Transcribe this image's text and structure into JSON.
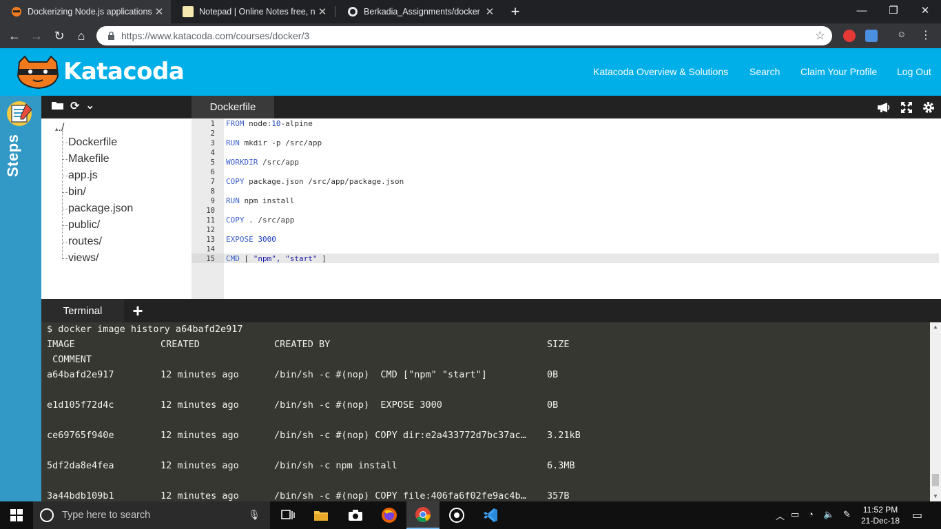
{
  "browser": {
    "tabs": [
      {
        "title": "Dockerizing Node.js applications",
        "active": true
      },
      {
        "title": "Notepad | Online Notes free, no",
        "active": false
      },
      {
        "title": "Berkadia_Assignments/docker ex",
        "active": false
      }
    ],
    "new_tab": "+",
    "url": "https://www.katacoda.com/courses/docker/3"
  },
  "header": {
    "logo_text": "Katacoda",
    "nav": [
      {
        "label": "Katacoda Overview & Solutions"
      },
      {
        "label": "Search"
      },
      {
        "label": "Claim Your Profile"
      },
      {
        "label": "Log Out"
      }
    ]
  },
  "sidebar": {
    "label": "Steps"
  },
  "file_tree": {
    "root": "./",
    "items": [
      "Dockerfile",
      "Makefile",
      "app.js",
      "bin/",
      "package.json",
      "public/",
      "routes/",
      "views/"
    ]
  },
  "editor": {
    "tab": "Dockerfile",
    "lines": [
      {
        "n": "1",
        "kw": "FROM",
        "rest": " node:",
        "num": "10",
        "tail": "-alpine"
      },
      {
        "n": "2"
      },
      {
        "n": "3",
        "kw": "RUN",
        "rest": " mkdir -p /src/app"
      },
      {
        "n": "4"
      },
      {
        "n": "5",
        "kw": "WORKDIR",
        "rest": " /src/app"
      },
      {
        "n": "6"
      },
      {
        "n": "7",
        "kw": "COPY",
        "rest": " package.json /src/app/package.json"
      },
      {
        "n": "8"
      },
      {
        "n": "9",
        "kw": "RUN",
        "rest": " npm install"
      },
      {
        "n": "10"
      },
      {
        "n": "11",
        "kw": "COPY",
        "rest": " . /src/app"
      },
      {
        "n": "12"
      },
      {
        "n": "13",
        "kw": "EXPOSE",
        "rest": " ",
        "num": "3000"
      },
      {
        "n": "14"
      },
      {
        "n": "15",
        "kw": "CMD",
        "rest": " [ ",
        "str": "\"npm\", \"start\"",
        "tail": " ]"
      }
    ]
  },
  "terminal": {
    "tab": "Terminal",
    "command": "$ docker image history a64bafd2e917",
    "headers": {
      "image": "IMAGE",
      "created": "CREATED",
      "created_by": "CREATED BY",
      "size": "SIZE",
      "comment": " COMMENT"
    },
    "rows": [
      {
        "image": "a64bafd2e917",
        "created": "12 minutes ago",
        "created_by": "/bin/sh -c #(nop)  CMD [\"npm\" \"start\"]",
        "size": "0B"
      },
      {
        "image": "e1d105f72d4c",
        "created": "12 minutes ago",
        "created_by": "/bin/sh -c #(nop)  EXPOSE 3000",
        "size": "0B"
      },
      {
        "image": "ce69765f940e",
        "created": "12 minutes ago",
        "created_by": "/bin/sh -c #(nop) COPY dir:e2a433772d7bc37ac…",
        "size": "3.21kB"
      },
      {
        "image": "5df2da8e4fea",
        "created": "12 minutes ago",
        "created_by": "/bin/sh -c npm install",
        "size": "6.3MB"
      },
      {
        "image": "3a44bdb109b1",
        "created": "12 minutes ago",
        "created_by": "/bin/sh -c #(nop) COPY file:406fa6f02fe9ac4b…",
        "size": "357B"
      }
    ]
  },
  "taskbar": {
    "search_placeholder": "Type here to search",
    "time": "11:52 PM",
    "date": "21-Dec-18"
  },
  "colors": {
    "katacoda_blue": "#00aee8",
    "steps_blue": "#3298c6",
    "terminal_bg": "#373731",
    "keyword": "#3a5fc8"
  }
}
